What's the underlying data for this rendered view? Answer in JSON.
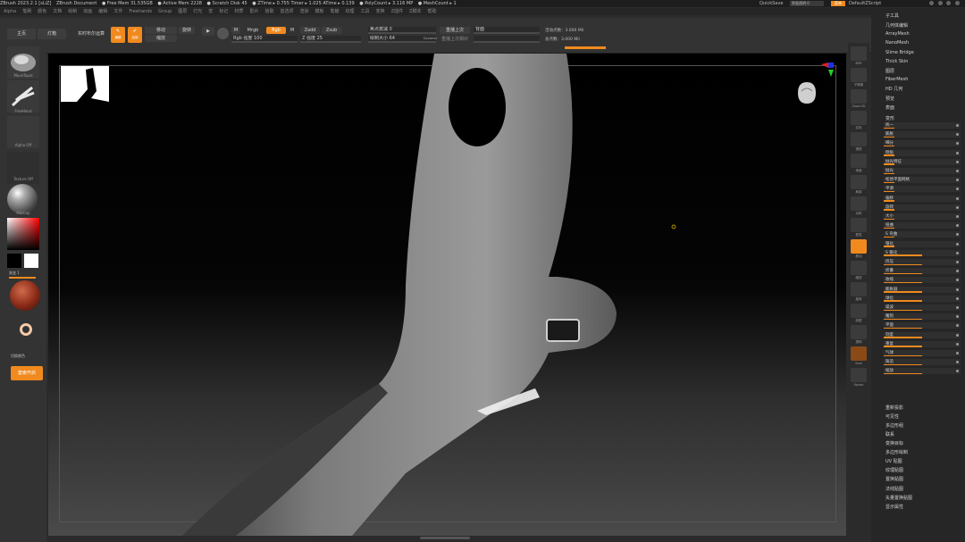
{
  "titlebar": {
    "items": [
      "ZBrush 2023.2.1 [sLiZ]",
      "ZBrush Document",
      "● Free Mem 31.535GB",
      "● Active Mem 2228",
      "● Scratch Disk 45",
      "● ZTime ▸ 0.755 Timer ▸ 1.025 ATime ▸ 0.139",
      "● PolyCount ▸ 3.116 MP",
      "● MeshCount ▸ 1"
    ],
    "quicksave": "QuickSave",
    "transparency_label": "界面透明 0",
    "menu_button": "菜单",
    "default_script": "DefaultZScript"
  },
  "menu_items": [
    "Alpha",
    "笔刷",
    "颜色",
    "文档",
    "绘制",
    "动画",
    "编辑",
    "文件",
    "Freehands",
    "Group",
    "图层",
    "灯光",
    "宏",
    "标记",
    "材质",
    "影片",
    "拾取",
    "首选项",
    "渲染",
    "模板",
    "笔触",
    "纹理",
    "工具",
    "变换",
    "Z插件",
    "Z脚本",
    "帮助"
  ],
  "toolbar": {
    "tab_home": "主页",
    "tab_lightbox": "灯箱",
    "live_boolean": "实时布尔运算",
    "edit_label": "编辑",
    "draw_label": "绘制",
    "move_label": "移动",
    "scale_label": "缩放",
    "rotate_label": "旋转",
    "mrgb": "Mrgb",
    "rgb": "Rgb",
    "m": "M",
    "zadd": "Zadd",
    "zsub": "Zsub",
    "rgb_intensity": "Rgb 强度 100",
    "z_intensity": "Z 强度 25",
    "focal_shift": "焦点衰减 0",
    "draw_size": "绘制大小 64",
    "dynamic": "Dynamic",
    "active_points": "活动点数：3.000 Mil",
    "total_points": "总点数：3.000 Mil",
    "backface": "背面",
    "replay_last": "重播上次",
    "replay_rel": "重播上次相对"
  },
  "left_panel": {
    "brush_label": "MoveTopol",
    "stroke_label": "FreeHand",
    "alpha_label": "Alpha Off",
    "texture_label": "Texture Off",
    "material_label": "MatCap",
    "gradient_label": "渐变 1",
    "switch_color": "切换颜色",
    "mode_label": "套索开启"
  },
  "right_strip": {
    "icons": [
      {
        "name": "bpr-icon",
        "label": "BPR"
      },
      {
        "name": "subpixel-icon",
        "label": "子像素"
      },
      {
        "name": "zoom2d-icon",
        "label": "Zoom2D"
      },
      {
        "name": "actual-icon",
        "label": "实际"
      },
      {
        "name": "persp-icon",
        "label": "透视"
      },
      {
        "name": "floor-icon",
        "label": "地面"
      },
      {
        "name": "local-icon",
        "label": "局部"
      },
      {
        "name": "sym-icon",
        "label": "对称"
      },
      {
        "name": "frame-icon",
        "label": "框显"
      },
      {
        "name": "move-icon",
        "label": "移动"
      },
      {
        "name": "zoom3d-icon",
        "label": "缩放"
      },
      {
        "name": "rotate-icon",
        "label": "旋转"
      },
      {
        "name": "linefill-icon",
        "label": "线框"
      },
      {
        "name": "transp-icon",
        "label": "透明"
      },
      {
        "name": "solo-icon",
        "label": "Solo"
      },
      {
        "name": "xpose-icon",
        "label": "Xpose"
      }
    ]
  },
  "right_panel": {
    "header": "子工具",
    "top_items": [
      "几何体编辑",
      "ArrayMesh",
      "NanoMesh",
      "Slime Bridge",
      "Thick Skin",
      "图层",
      "FiberMesh",
      "HD 几何",
      "预览",
      "表面"
    ],
    "deform_header": "变形",
    "deform_rows": [
      "统一",
      "膨胀",
      "细分",
      "倒角",
      "抛光特征",
      "抛光",
      "松弛平面网格",
      "平滑",
      "偏移",
      "旋转",
      "大小",
      "扭曲",
      "S 弯曲",
      "锥化",
      "S 锥化",
      "挤压",
      "折叠",
      "收缩",
      "膨胀器",
      "球化",
      "噪波",
      "雕刻",
      "平面",
      "刻度",
      "重复",
      "气球",
      "铸造",
      "缩放"
    ],
    "bottom_items": [
      "重新投影",
      "可见性",
      "多边形组",
      "联系",
      "变换目标",
      "多边形绘制",
      "UV 贴图",
      "纹理贴图",
      "置换贴图",
      "法线贴图",
      "矢量置换贴图",
      "显示属性"
    ]
  }
}
